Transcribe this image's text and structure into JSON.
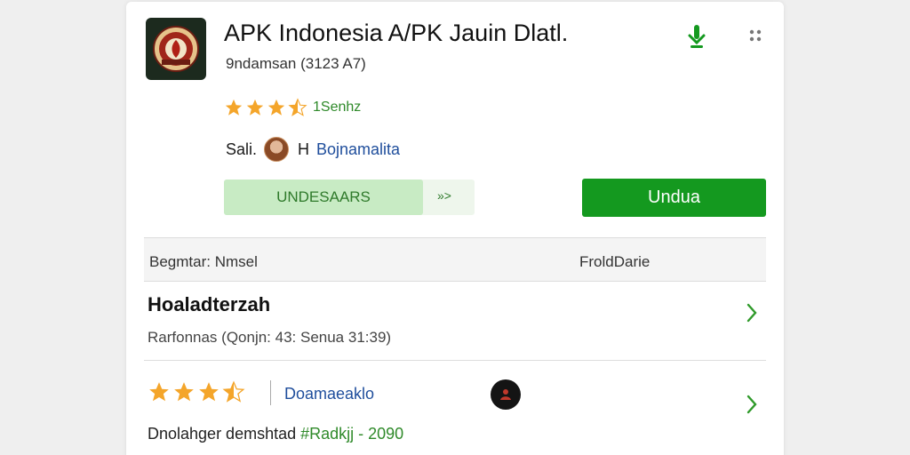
{
  "app": {
    "title": "APK Indonesia  A/PK Jauin Dlatl.",
    "subtitle": "9ndamsan (3123 A7)",
    "icon": "shield-emblem-icon",
    "rating": {
      "stars": 3.5,
      "max": 5,
      "text": "1Senhz"
    },
    "developer_prefix": "Sali.",
    "developer_letter": "H",
    "developer_name": "Bojnamalita"
  },
  "actions": {
    "secondary_label": "UNDESAARS",
    "secondary_arrow": "»>",
    "primary_label": "Undua"
  },
  "table": {
    "header_left": "Begmtar: Nmsel",
    "header_right": "FroldDarie"
  },
  "rows": [
    {
      "title": "Hoaladterzah",
      "meta": "Rarfonnas (Qonjn: 43: Senua 31:39)"
    },
    {
      "rating": 3.5,
      "developer": "Doamaeaklo",
      "meta_prefix": "Dnolahger demshtad  ",
      "meta_tag": "#Radkjj - 2090"
    }
  ],
  "colors": {
    "accent_green": "#14991f",
    "light_green": "#c8ebc4",
    "star": "#f4a52a",
    "link_blue": "#1f4e9c"
  }
}
